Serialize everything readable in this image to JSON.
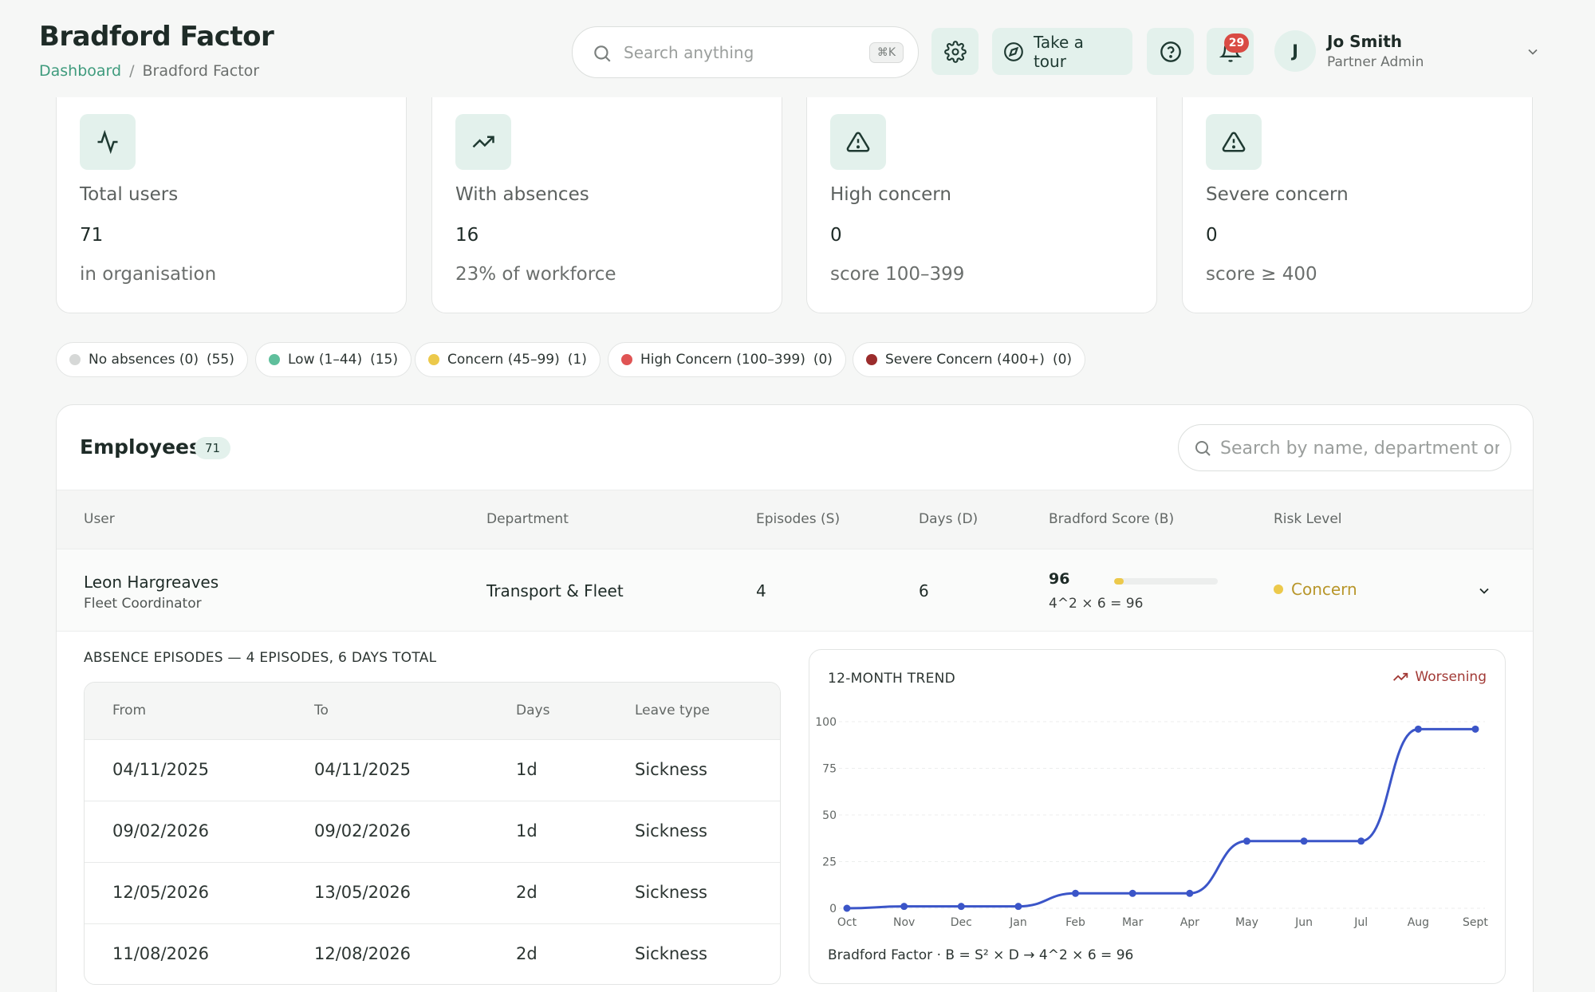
{
  "header": {
    "title": "Bradford Factor",
    "breadcrumb": {
      "home": "Dashboard",
      "separator": "/",
      "current": "Bradford Factor"
    },
    "search": {
      "placeholder": "Search anything",
      "shortcut": "⌘K"
    },
    "tour_label": "Take a tour",
    "notifications_count": "29",
    "user": {
      "initial": "J",
      "name": "Jo Smith",
      "role": "Partner Admin"
    }
  },
  "stats": [
    {
      "icon": "activity-icon",
      "label": "Total users",
      "value": "71",
      "sub": "in organisation"
    },
    {
      "icon": "trending-up-icon",
      "label": "With absences",
      "value": "16",
      "sub": "23% of workforce"
    },
    {
      "icon": "warning-icon",
      "label": "High concern",
      "value": "0",
      "sub": "score 100–399"
    },
    {
      "icon": "warning-icon",
      "label": "Severe concern",
      "value": "0",
      "sub": "score ≥ 400"
    }
  ],
  "legend": [
    {
      "label": "No absences (0)",
      "count": "(55)",
      "color": "#d6d8d7"
    },
    {
      "label": "Low (1–44)",
      "count": "(15)",
      "color": "#5fbf9c"
    },
    {
      "label": "Concern (45–99)",
      "count": "(1)",
      "color": "#ecc94b"
    },
    {
      "label": "High Concern (100–399)",
      "count": "(0)",
      "color": "#e05454"
    },
    {
      "label": "Severe Concern (400+)",
      "count": "(0)",
      "color": "#9b2c2c"
    }
  ],
  "employees": {
    "title": "Employees",
    "count": "71",
    "search_placeholder": "Search by name, department or role",
    "columns": [
      "User",
      "Department",
      "Episodes (S)",
      "Days (D)",
      "Bradford Score (B)",
      "Risk Level"
    ],
    "rows": [
      {
        "name": "Leon Hargreaves",
        "job_title": "Fleet Coordinator",
        "department": "Transport & Fleet",
        "episodes": "4",
        "days": "6",
        "score": "96",
        "score_fraction": 0.096,
        "formula": "4^2 × 6 = 96",
        "risk": "Concern"
      }
    ]
  },
  "episodes": {
    "title": "ABSENCE EPISODES — 4 EPISODES, 6 DAYS TOTAL",
    "columns": [
      "From",
      "To",
      "Days",
      "Leave type"
    ],
    "rows": [
      {
        "from": "04/11/2025",
        "to": "04/11/2025",
        "days": "1d",
        "type": "Sickness"
      },
      {
        "from": "09/02/2026",
        "to": "09/02/2026",
        "days": "1d",
        "type": "Sickness"
      },
      {
        "from": "12/05/2026",
        "to": "13/05/2026",
        "days": "2d",
        "type": "Sickness"
      },
      {
        "from": "11/08/2026",
        "to": "12/08/2026",
        "days": "2d",
        "type": "Sickness"
      }
    ]
  },
  "trend": {
    "title": "12-MONTH TREND",
    "status": "Worsening",
    "footer": "Bradford Factor · B = S² × D → 4^2 × 6 = 96"
  },
  "chart_data": {
    "type": "line",
    "x": [
      "Oct",
      "Nov",
      "Dec",
      "Jan",
      "Feb",
      "Mar",
      "Apr",
      "May",
      "Jun",
      "Jul",
      "Aug",
      "Sept"
    ],
    "y_ticks": [
      "0",
      "25",
      "50",
      "75",
      "100"
    ],
    "ylim": [
      0,
      100
    ],
    "series": [
      {
        "values": [
          0,
          1,
          1,
          1,
          8,
          8,
          8,
          36,
          36,
          36,
          96,
          96
        ],
        "color": "#3b55c8"
      }
    ],
    "grid": true
  }
}
